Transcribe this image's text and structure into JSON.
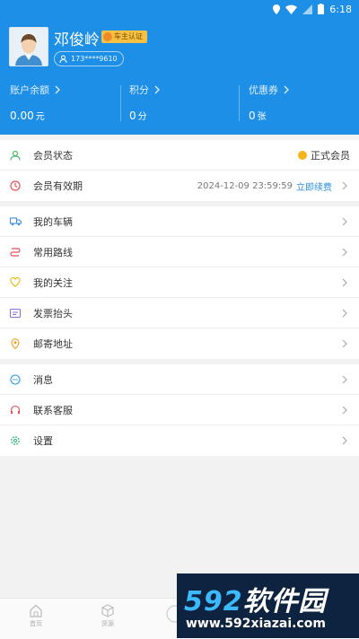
{
  "status_bar": {
    "time": "6:18"
  },
  "profile": {
    "name": "邓俊岭",
    "badge": "车主认证",
    "phone": "173****9610"
  },
  "stats": [
    {
      "label": "账户余额",
      "value": "0.00",
      "unit": "元"
    },
    {
      "label": "积分",
      "value": "0",
      "unit": "分"
    },
    {
      "label": "优惠券",
      "value": "0",
      "unit": "张"
    }
  ],
  "membership": {
    "status_label": "会员状态",
    "status_value": "正式会员",
    "expiry_label": "会员有效期",
    "expiry_value": "2024-12-09 23:59:59",
    "renew_label": "立即续费"
  },
  "menu": [
    {
      "label": "我的车辆",
      "icon": "truck-icon"
    },
    {
      "label": "常用路线",
      "icon": "route-icon"
    },
    {
      "label": "我的关注",
      "icon": "heart-icon"
    },
    {
      "label": "发票抬头",
      "icon": "invoice-icon"
    },
    {
      "label": "邮寄地址",
      "icon": "location-icon"
    }
  ],
  "menu2": [
    {
      "label": "消息",
      "icon": "message-icon"
    },
    {
      "label": "联系客服",
      "icon": "headset-icon"
    },
    {
      "label": "设置",
      "icon": "gear-icon"
    }
  ],
  "tabs": [
    {
      "label": "首页",
      "icon": "home-icon"
    },
    {
      "label": "货源",
      "icon": "box-icon"
    }
  ],
  "watermark": {
    "num": "592",
    "text": "软件园",
    "url": "www.592xiazai.com"
  },
  "colors": {
    "primary": "#1e8fe6",
    "link": "#2a8ee6",
    "gold": "#f5b51a"
  }
}
